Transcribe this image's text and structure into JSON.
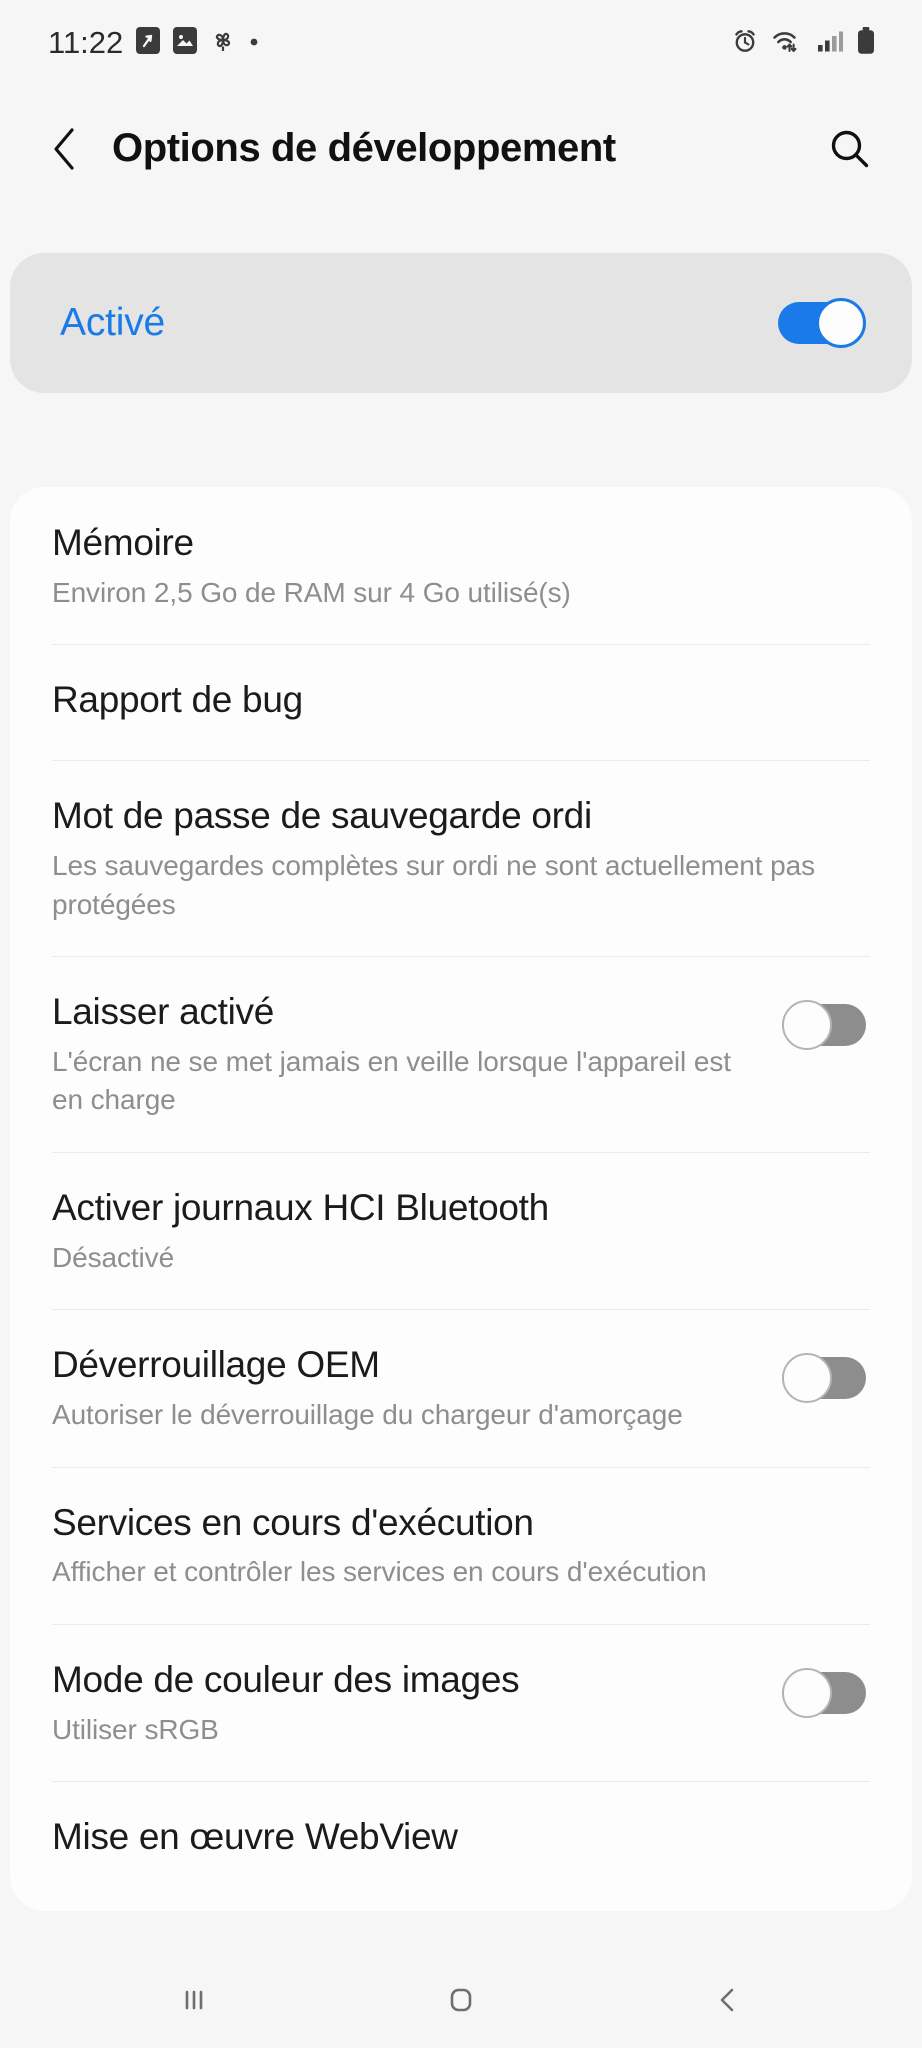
{
  "status_bar": {
    "time": "11:22",
    "left_icons": [
      "share-notification-icon",
      "image-notification-icon",
      "pinwheel-notification-icon",
      "more-notifications-dot-icon"
    ],
    "right_icons": [
      "alarm-icon",
      "wifi-icon",
      "cellular-signal-icon",
      "battery-icon"
    ]
  },
  "header": {
    "back_icon": "back-chevron-icon",
    "title": "Options de développement",
    "search_icon": "search-icon"
  },
  "master_toggle": {
    "label": "Activé",
    "state": "on",
    "accent_color": "#1a7ae8"
  },
  "settings_list": [
    {
      "title": "Mémoire",
      "subtitle": "Environ 2,5 Go de RAM sur 4 Go utilisé(s)",
      "control": "none"
    },
    {
      "title": "Rapport de bug",
      "subtitle": "",
      "control": "none"
    },
    {
      "title": "Mot de passe de sauvegarde ordi",
      "subtitle": "Les sauvegardes complètes sur ordi ne sont actuellement pas protégées",
      "control": "none"
    },
    {
      "title": "Laisser activé",
      "subtitle": "L'écran ne se met jamais en veille lorsque l'appareil est en charge",
      "control": "switch",
      "state": "off"
    },
    {
      "title": "Activer journaux HCI Bluetooth",
      "subtitle": "Désactivé",
      "control": "none"
    },
    {
      "title": "Déverrouillage OEM",
      "subtitle": "Autoriser le déverrouillage du chargeur d'amorçage",
      "control": "switch",
      "state": "off"
    },
    {
      "title": "Services en cours d'exécution",
      "subtitle": "Afficher et contrôler les services en cours d'exécution",
      "control": "none"
    },
    {
      "title": "Mode de couleur des images",
      "subtitle": "Utiliser sRGB",
      "control": "switch",
      "state": "off"
    },
    {
      "title": "Mise en œuvre WebView",
      "subtitle": "",
      "control": "none"
    }
  ],
  "nav_bar": {
    "recents_icon": "recents-icon",
    "home_icon": "home-icon",
    "back_icon": "back-icon"
  },
  "colors": {
    "page_background": "#f6f6f6",
    "card_background": "#fdfdfd",
    "master_card_background": "#e4e4e4",
    "accent": "#1a7ae8",
    "title_text": "#1b1b1b",
    "subtitle_text": "#8e8e8e",
    "switch_off_track": "#8d8d8d"
  }
}
